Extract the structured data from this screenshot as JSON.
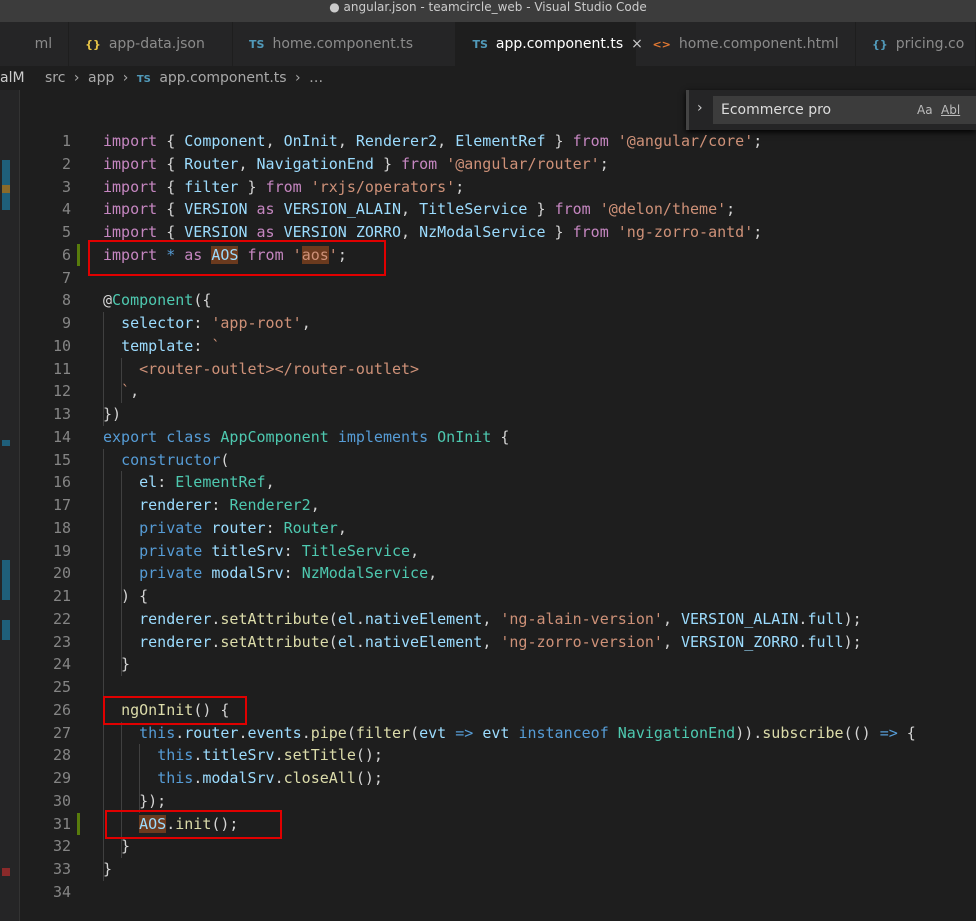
{
  "window": {
    "title": "● angular.json - teamcircle_web - Visual Studio Code"
  },
  "tabs": [
    {
      "icon": "",
      "label": "ml",
      "icon_color": "#e8c547"
    },
    {
      "icon": "{}",
      "label": "app-data.json",
      "icon_color": "#e8c547"
    },
    {
      "icon": "TS",
      "label": "home.component.ts",
      "icon_color": "#519aba"
    },
    {
      "icon": "TS",
      "label": "app.component.ts",
      "icon_color": "#519aba",
      "active": true,
      "close": "×"
    },
    {
      "icon": "<>",
      "label": "home.component.html",
      "icon_color": "#e37933"
    },
    {
      "icon": "{}",
      "label": "pricing.co",
      "icon_color": "#519aba"
    }
  ],
  "sidebar_fragment": "alM",
  "breadcrumb": {
    "parts": [
      "src",
      "app"
    ],
    "file_icon": "TS",
    "file": "app.component.ts",
    "more": "…",
    "sep": "›"
  },
  "find": {
    "value": "Ecommerce pro",
    "match_case": "Aa",
    "whole_word": "Abl"
  },
  "colors": {
    "keyword": "#c586c0",
    "storage": "#569cd6",
    "variable": "#9cdcfe",
    "type": "#4ec9b0",
    "string": "#ce9178",
    "function": "#dcdcaa",
    "highlight_box": "#e00000"
  },
  "code": [
    [
      [
        "k",
        "import"
      ],
      [
        "p",
        " { "
      ],
      [
        "v",
        "Component"
      ],
      [
        "p",
        ", "
      ],
      [
        "v",
        "OnInit"
      ],
      [
        "p",
        ", "
      ],
      [
        "v",
        "Renderer2"
      ],
      [
        "p",
        ", "
      ],
      [
        "v",
        "ElementRef"
      ],
      [
        "p",
        " } "
      ],
      [
        "k",
        "from"
      ],
      [
        "p",
        " "
      ],
      [
        "s",
        "'@angular/core'"
      ],
      [
        "p",
        ";"
      ]
    ],
    [
      [
        "k",
        "import"
      ],
      [
        "p",
        " { "
      ],
      [
        "v",
        "Router"
      ],
      [
        "p",
        ", "
      ],
      [
        "v",
        "NavigationEnd"
      ],
      [
        "p",
        " } "
      ],
      [
        "k",
        "from"
      ],
      [
        "p",
        " "
      ],
      [
        "s",
        "'@angular/router'"
      ],
      [
        "p",
        ";"
      ]
    ],
    [
      [
        "k",
        "import"
      ],
      [
        "p",
        " { "
      ],
      [
        "v",
        "filter"
      ],
      [
        "p",
        " } "
      ],
      [
        "k",
        "from"
      ],
      [
        "p",
        " "
      ],
      [
        "s",
        "'rxjs/operators'"
      ],
      [
        "p",
        ";"
      ]
    ],
    [
      [
        "k",
        "import"
      ],
      [
        "p",
        " { "
      ],
      [
        "v",
        "VERSION"
      ],
      [
        "p",
        " "
      ],
      [
        "k",
        "as"
      ],
      [
        "p",
        " "
      ],
      [
        "v",
        "VERSION_ALAIN"
      ],
      [
        "p",
        ", "
      ],
      [
        "v",
        "TitleService"
      ],
      [
        "p",
        " } "
      ],
      [
        "k",
        "from"
      ],
      [
        "p",
        " "
      ],
      [
        "s",
        "'@delon/theme'"
      ],
      [
        "p",
        ";"
      ]
    ],
    [
      [
        "k",
        "import"
      ],
      [
        "p",
        " { "
      ],
      [
        "v",
        "VERSION"
      ],
      [
        "p",
        " "
      ],
      [
        "k",
        "as"
      ],
      [
        "p",
        " "
      ],
      [
        "v",
        "VERSION_ZORRO"
      ],
      [
        "p",
        ", "
      ],
      [
        "v",
        "NzModalService"
      ],
      [
        "p",
        " } "
      ],
      [
        "k",
        "from"
      ],
      [
        "p",
        " "
      ],
      [
        "s",
        "'ng-zorro-antd'"
      ],
      [
        "p",
        ";"
      ]
    ],
    [
      [
        "k",
        "import"
      ],
      [
        "p",
        " "
      ],
      [
        "b",
        "*"
      ],
      [
        "p",
        " "
      ],
      [
        "k",
        "as"
      ],
      [
        "p",
        " "
      ],
      [
        "v h",
        "AOS"
      ],
      [
        "p",
        " "
      ],
      [
        "k",
        "from"
      ],
      [
        "p",
        " "
      ],
      [
        "s",
        "'"
      ],
      [
        "s h",
        "aos"
      ],
      [
        "s",
        "'"
      ],
      [
        "p",
        ";"
      ]
    ],
    [],
    [
      [
        "p",
        "@"
      ],
      [
        "t",
        "Component"
      ],
      [
        "p",
        "({"
      ]
    ],
    [
      [
        "p",
        "  "
      ],
      [
        "v",
        "selector"
      ],
      [
        "p",
        ": "
      ],
      [
        "s",
        "'app-root'"
      ],
      [
        "p",
        ","
      ]
    ],
    [
      [
        "p",
        "  "
      ],
      [
        "v",
        "template"
      ],
      [
        "p",
        ": "
      ],
      [
        "s",
        "`"
      ]
    ],
    [
      [
        "s",
        "    <router-outlet></router-outlet>"
      ]
    ],
    [
      [
        "s",
        "  `"
      ],
      [
        "p",
        ","
      ]
    ],
    [
      [
        "p",
        "})"
      ]
    ],
    [
      [
        "b",
        "export"
      ],
      [
        "p",
        " "
      ],
      [
        "b",
        "class"
      ],
      [
        "p",
        " "
      ],
      [
        "t",
        "AppComponent"
      ],
      [
        "p",
        " "
      ],
      [
        "b",
        "implements"
      ],
      [
        "p",
        " "
      ],
      [
        "t",
        "OnInit"
      ],
      [
        "p",
        " {"
      ]
    ],
    [
      [
        "p",
        "  "
      ],
      [
        "b",
        "constructor"
      ],
      [
        "p",
        "("
      ]
    ],
    [
      [
        "p",
        "    "
      ],
      [
        "v",
        "el"
      ],
      [
        "p",
        ": "
      ],
      [
        "t",
        "ElementRef"
      ],
      [
        "p",
        ","
      ]
    ],
    [
      [
        "p",
        "    "
      ],
      [
        "v",
        "renderer"
      ],
      [
        "p",
        ": "
      ],
      [
        "t",
        "Renderer2"
      ],
      [
        "p",
        ","
      ]
    ],
    [
      [
        "p",
        "    "
      ],
      [
        "b",
        "private"
      ],
      [
        "p",
        " "
      ],
      [
        "v",
        "router"
      ],
      [
        "p",
        ": "
      ],
      [
        "t",
        "Router"
      ],
      [
        "p",
        ","
      ]
    ],
    [
      [
        "p",
        "    "
      ],
      [
        "b",
        "private"
      ],
      [
        "p",
        " "
      ],
      [
        "v",
        "titleSrv"
      ],
      [
        "p",
        ": "
      ],
      [
        "t",
        "TitleService"
      ],
      [
        "p",
        ","
      ]
    ],
    [
      [
        "p",
        "    "
      ],
      [
        "b",
        "private"
      ],
      [
        "p",
        " "
      ],
      [
        "v",
        "modalSrv"
      ],
      [
        "p",
        ": "
      ],
      [
        "t",
        "NzModalService"
      ],
      [
        "p",
        ","
      ]
    ],
    [
      [
        "p",
        "  ) {"
      ]
    ],
    [
      [
        "p",
        "    "
      ],
      [
        "v",
        "renderer"
      ],
      [
        "p",
        "."
      ],
      [
        "f",
        "setAttribute"
      ],
      [
        "p",
        "("
      ],
      [
        "v",
        "el"
      ],
      [
        "p",
        "."
      ],
      [
        "v",
        "nativeElement"
      ],
      [
        "p",
        ", "
      ],
      [
        "s",
        "'ng-alain-version'"
      ],
      [
        "p",
        ", "
      ],
      [
        "v",
        "VERSION_ALAIN"
      ],
      [
        "p",
        "."
      ],
      [
        "v",
        "full"
      ],
      [
        "p",
        ");"
      ]
    ],
    [
      [
        "p",
        "    "
      ],
      [
        "v",
        "renderer"
      ],
      [
        "p",
        "."
      ],
      [
        "f",
        "setAttribute"
      ],
      [
        "p",
        "("
      ],
      [
        "v",
        "el"
      ],
      [
        "p",
        "."
      ],
      [
        "v",
        "nativeElement"
      ],
      [
        "p",
        ", "
      ],
      [
        "s",
        "'ng-zorro-version'"
      ],
      [
        "p",
        ", "
      ],
      [
        "v",
        "VERSION_ZORRO"
      ],
      [
        "p",
        "."
      ],
      [
        "v",
        "full"
      ],
      [
        "p",
        ");"
      ]
    ],
    [
      [
        "p",
        "  }"
      ]
    ],
    [],
    [
      [
        "p",
        "  "
      ],
      [
        "f",
        "ngOnInit"
      ],
      [
        "p",
        "() {"
      ]
    ],
    [
      [
        "p",
        "    "
      ],
      [
        "b",
        "this"
      ],
      [
        "p",
        "."
      ],
      [
        "v",
        "router"
      ],
      [
        "p",
        "."
      ],
      [
        "v",
        "events"
      ],
      [
        "p",
        "."
      ],
      [
        "f",
        "pipe"
      ],
      [
        "p",
        "("
      ],
      [
        "f",
        "filter"
      ],
      [
        "p",
        "("
      ],
      [
        "v",
        "evt"
      ],
      [
        "p",
        " "
      ],
      [
        "b",
        "=>"
      ],
      [
        "p",
        " "
      ],
      [
        "v",
        "evt"
      ],
      [
        "p",
        " "
      ],
      [
        "b",
        "instanceof"
      ],
      [
        "p",
        " "
      ],
      [
        "t",
        "NavigationEnd"
      ],
      [
        "p",
        "))."
      ],
      [
        "f",
        "subscribe"
      ],
      [
        "p",
        "(() "
      ],
      [
        "b",
        "=>"
      ],
      [
        "p",
        " {"
      ]
    ],
    [
      [
        "p",
        "      "
      ],
      [
        "b",
        "this"
      ],
      [
        "p",
        "."
      ],
      [
        "v",
        "titleSrv"
      ],
      [
        "p",
        "."
      ],
      [
        "f",
        "setTitle"
      ],
      [
        "p",
        "();"
      ]
    ],
    [
      [
        "p",
        "      "
      ],
      [
        "b",
        "this"
      ],
      [
        "p",
        "."
      ],
      [
        "v",
        "modalSrv"
      ],
      [
        "p",
        "."
      ],
      [
        "f",
        "closeAll"
      ],
      [
        "p",
        "();"
      ]
    ],
    [
      [
        "p",
        "    });"
      ]
    ],
    [
      [
        "p",
        "    "
      ],
      [
        "v h",
        "AOS"
      ],
      [
        "p",
        "."
      ],
      [
        "f",
        "init"
      ],
      [
        "p",
        "();"
      ]
    ],
    [
      [
        "p",
        "  }"
      ]
    ],
    [
      [
        "p",
        "}"
      ]
    ],
    []
  ]
}
